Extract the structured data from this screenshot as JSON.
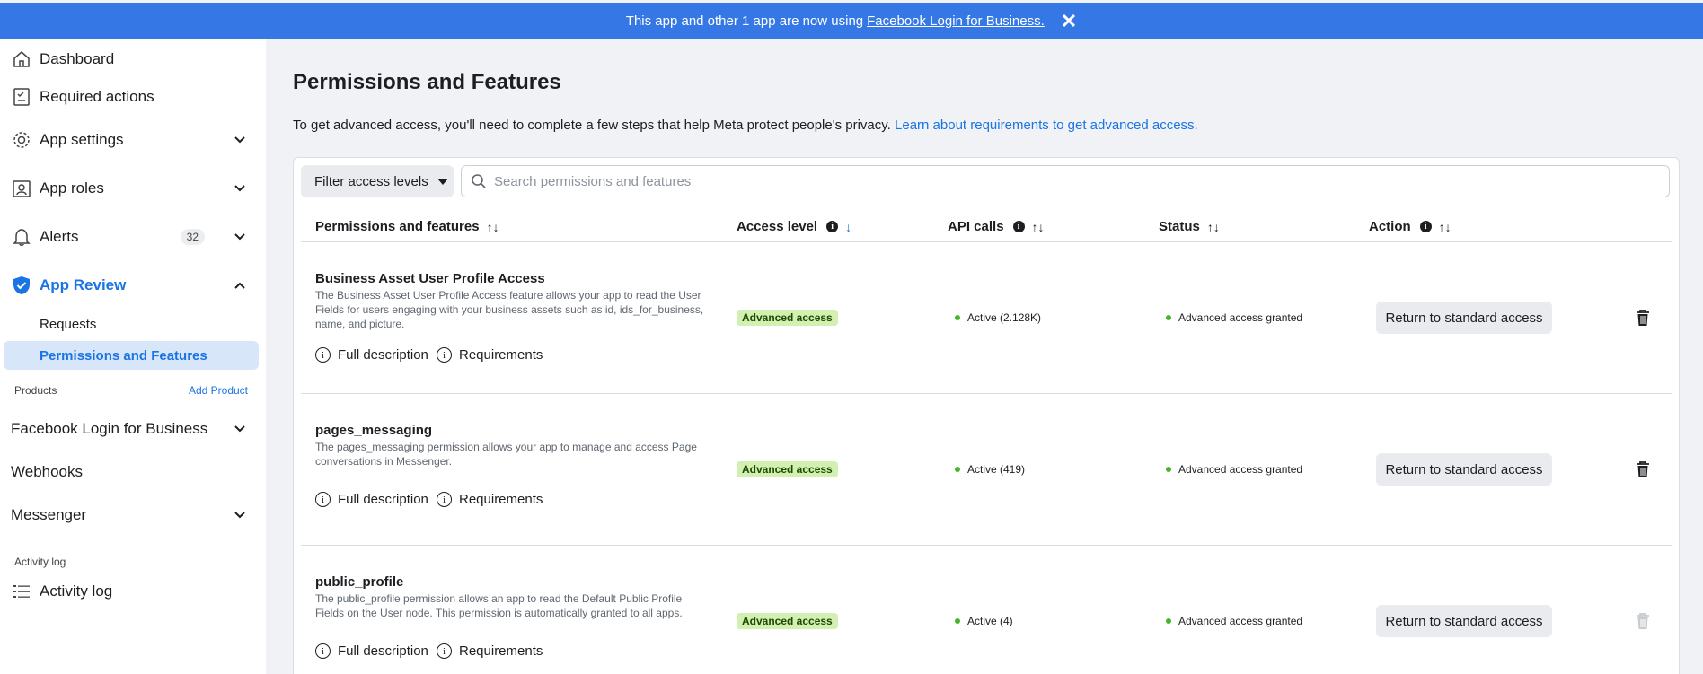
{
  "banner": {
    "text": "This app and other 1 app are now using",
    "link": "Facebook Login for Business.",
    "close": "✕"
  },
  "sidebar": {
    "items": [
      {
        "label": "Dashboard",
        "icon": "home-icon"
      },
      {
        "label": "Required actions",
        "icon": "clipboard-check-icon"
      },
      {
        "label": "App settings",
        "icon": "gear-icon"
      },
      {
        "label": "App roles",
        "icon": "id-badge-icon"
      },
      {
        "label": "Alerts",
        "icon": "bell-icon",
        "badge": "32"
      },
      {
        "label": "App Review",
        "icon": "shield-check-icon"
      }
    ],
    "app_review_sub": [
      "Requests",
      "Permissions and Features"
    ],
    "products_label": "Products",
    "add_product": "Add Product",
    "products": [
      "Facebook Login for Business",
      "Webhooks",
      "Messenger"
    ],
    "activity_section": "Activity log",
    "activity_item": "Activity log"
  },
  "main": {
    "title": "Permissions and Features",
    "desc": "To get advanced access, you'll need to complete a few steps that help Meta protect people's privacy.",
    "desc_link": "Learn about requirements to get advanced access."
  },
  "toolbar": {
    "filter_label": "Filter access levels",
    "search_placeholder": "Search permissions and features"
  },
  "table": {
    "columns": [
      "Permissions and features",
      "Access level",
      "API calls",
      "Status",
      "Action"
    ],
    "sort_glyph": "↑↓",
    "sort_active_glyph": "↓",
    "info_glyph": "i",
    "full_description": "Full description",
    "requirements": "Requirements",
    "rows": [
      {
        "name": "Business Asset User Profile Access",
        "desc": "The Business Asset User Profile Access feature allows your app to read the User Fields for users engaging with your business assets such as id, ids_for_business, name, and picture.",
        "access": "Advanced access",
        "api_calls": "Active (2.128K)",
        "status": "Advanced access granted",
        "action": "Return to standard access"
      },
      {
        "name": "pages_messaging",
        "desc": "The pages_messaging permission allows your app to manage and access Page conversations in Messenger.",
        "access": "Advanced access",
        "api_calls": "Active (419)",
        "status": "Advanced access granted",
        "action": "Return to standard access"
      },
      {
        "name": "public_profile",
        "desc": "The public_profile permission allows an app to read the Default Public Profile Fields on the User node. This permission is automatically granted to all apps.",
        "access": "Advanced access",
        "api_calls": "Active (4)",
        "status": "Advanced access granted",
        "action": "Return to standard access"
      }
    ]
  },
  "colors": {
    "banner": "#3578e5",
    "accent": "#1b74e4",
    "pill_bg": "#d1f0b1",
    "active_dot": "#42b72a"
  }
}
